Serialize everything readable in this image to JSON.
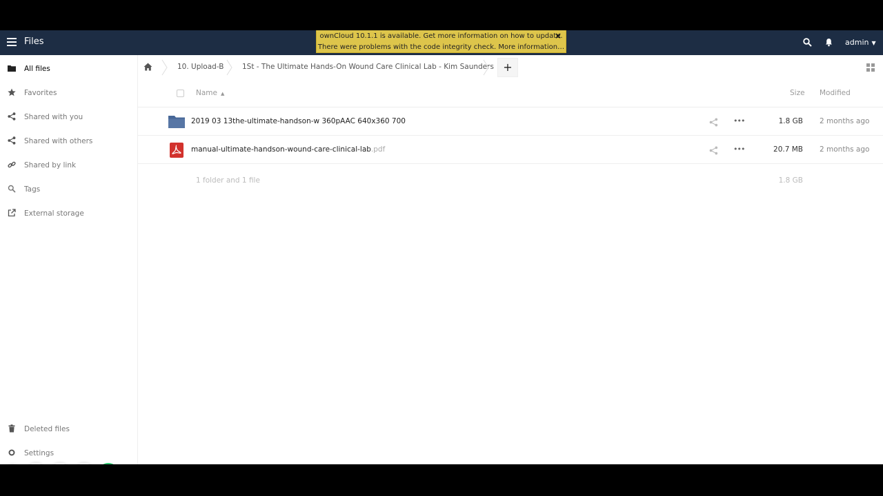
{
  "header": {
    "app_title": "Files",
    "notice_line1": "ownCloud 10.1.1 is available. Get more information on how to update.",
    "notice_line2": "There were problems with the code integrity check. More information…",
    "notice_close": "×",
    "user": "admin",
    "colors": {
      "bar": "#1d2d44",
      "notice": "#ddc54b"
    }
  },
  "sidebar": {
    "items": [
      {
        "label": "All files",
        "icon": "folder-icon"
      },
      {
        "label": "Favorites",
        "icon": "star-icon"
      },
      {
        "label": "Shared with you",
        "icon": "share-icon"
      },
      {
        "label": "Shared with others",
        "icon": "share-icon"
      },
      {
        "label": "Shared by link",
        "icon": "link-icon"
      },
      {
        "label": "Tags",
        "icon": "search-icon"
      },
      {
        "label": "External storage",
        "icon": "external-link-icon"
      }
    ],
    "deleted_files": "Deleted files",
    "settings": "Settings"
  },
  "breadcrumb": {
    "items": [
      "10. Upload-B",
      "1St - The Ultimate Hands-On Wound Care Clinical Lab - Kim Saunders"
    ],
    "new_label": "+"
  },
  "table": {
    "columns": {
      "name": "Name",
      "size": "Size",
      "modified": "Modified"
    },
    "rows": [
      {
        "name": "2019 03 13the-ultimate-handson-w 360pAAC 640x360 700",
        "ext": "",
        "type": "folder",
        "size": "1.8 GB",
        "modified": "2 months ago"
      },
      {
        "name": "manual-ultimate-handson-wound-care-clinical-lab",
        "ext": ".pdf",
        "type": "pdf",
        "size": "20.7 MB",
        "modified": "2 months ago"
      }
    ],
    "summary": {
      "count": "1 folder and 1 file",
      "total": "1.8 GB"
    }
  }
}
